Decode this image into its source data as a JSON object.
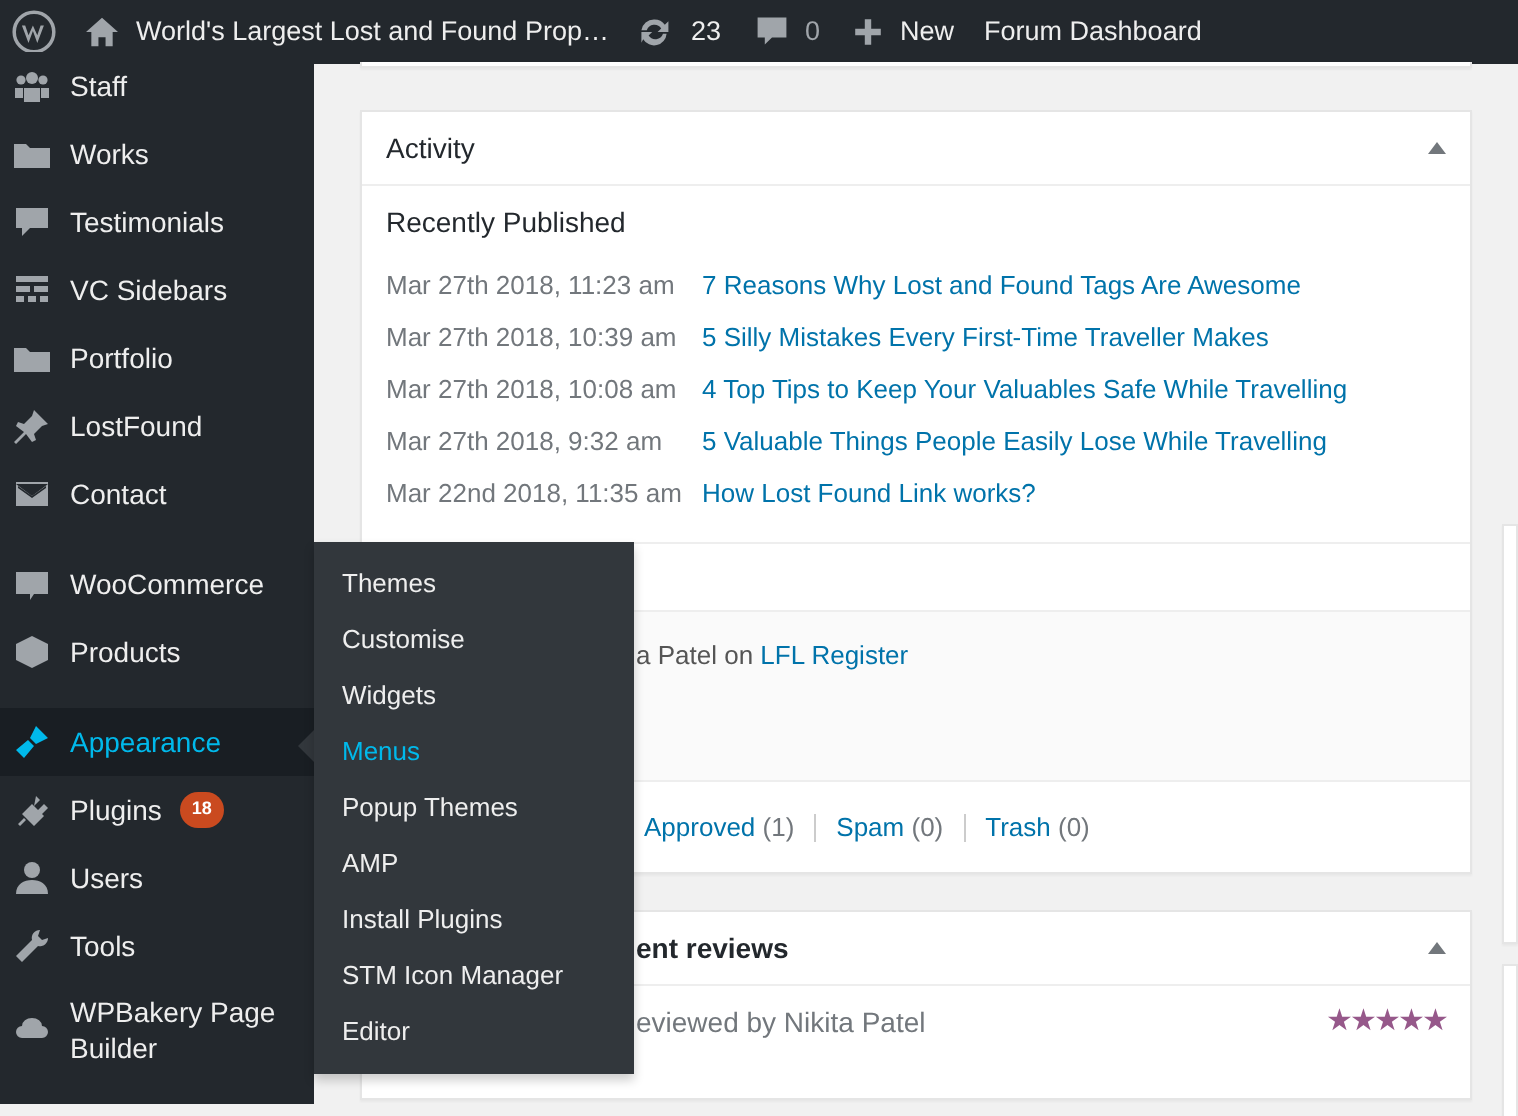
{
  "admin_bar": {
    "site_title": "World's Largest Lost and Found Prop…",
    "updates": "23",
    "comments": "0",
    "new": "New",
    "forum": "Forum Dashboard"
  },
  "sidebar": {
    "groups": [
      [
        {
          "label": "Staff",
          "selected": false
        },
        {
          "label": "Works",
          "selected": false
        },
        {
          "label": "Testimonials",
          "selected": false
        },
        {
          "label": "VC Sidebars",
          "selected": false
        },
        {
          "label": "Portfolio",
          "selected": false
        },
        {
          "label": "LostFound",
          "selected": false
        },
        {
          "label": "Contact",
          "selected": false
        }
      ],
      [
        {
          "label": "WooCommerce",
          "selected": false
        },
        {
          "label": "Products",
          "selected": false
        }
      ],
      [
        {
          "label": "Appearance",
          "selected": true
        },
        {
          "label": "Plugins",
          "selected": false,
          "badge": "18"
        },
        {
          "label": "Users",
          "selected": false
        },
        {
          "label": "Tools",
          "selected": false
        },
        {
          "label": "WPBakery Page Builder",
          "selected": false
        }
      ]
    ]
  },
  "submenu": [
    {
      "label": "Themes",
      "selected": false
    },
    {
      "label": "Customise",
      "selected": false
    },
    {
      "label": "Widgets",
      "selected": false
    },
    {
      "label": "Menus",
      "selected": true
    },
    {
      "label": "Popup Themes",
      "selected": false
    },
    {
      "label": "AMP",
      "selected": false
    },
    {
      "label": "Install Plugins",
      "selected": false
    },
    {
      "label": "STM Icon Manager",
      "selected": false
    },
    {
      "label": "Editor",
      "selected": false
    }
  ],
  "activity": {
    "title": "Activity",
    "subtitle": "Recently Published",
    "posts": [
      {
        "date": "Mar 27th 2018, 11:23 am",
        "title": "7 Reasons Why Lost and Found Tags Are Awesome"
      },
      {
        "date": "Mar 27th 2018, 10:39 am",
        "title": "5 Silly Mistakes Every First-Time Traveller Makes"
      },
      {
        "date": "Mar 27th 2018, 10:08 am",
        "title": "4 Top Tips to Keep Your Valuables Safe While Travelling"
      },
      {
        "date": "Mar 27th 2018, 9:32 am",
        "title": "5 Valuable Things People Easily Lose While Travelling"
      },
      {
        "date": "Mar 22nd 2018, 11:35 am",
        "title": "How Lost Found Link works?"
      }
    ],
    "comment": {
      "text": "a Patel on",
      "link": "LFL Register"
    },
    "filters": [
      {
        "label": "Approved",
        "count": "(1)"
      },
      {
        "label": "Spam",
        "count": "(0)"
      },
      {
        "label": "Trash",
        "count": "(0)"
      }
    ]
  },
  "reviews": {
    "title": "ent reviews",
    "item": "eviewed by Nikita Patel",
    "stars": 5
  }
}
